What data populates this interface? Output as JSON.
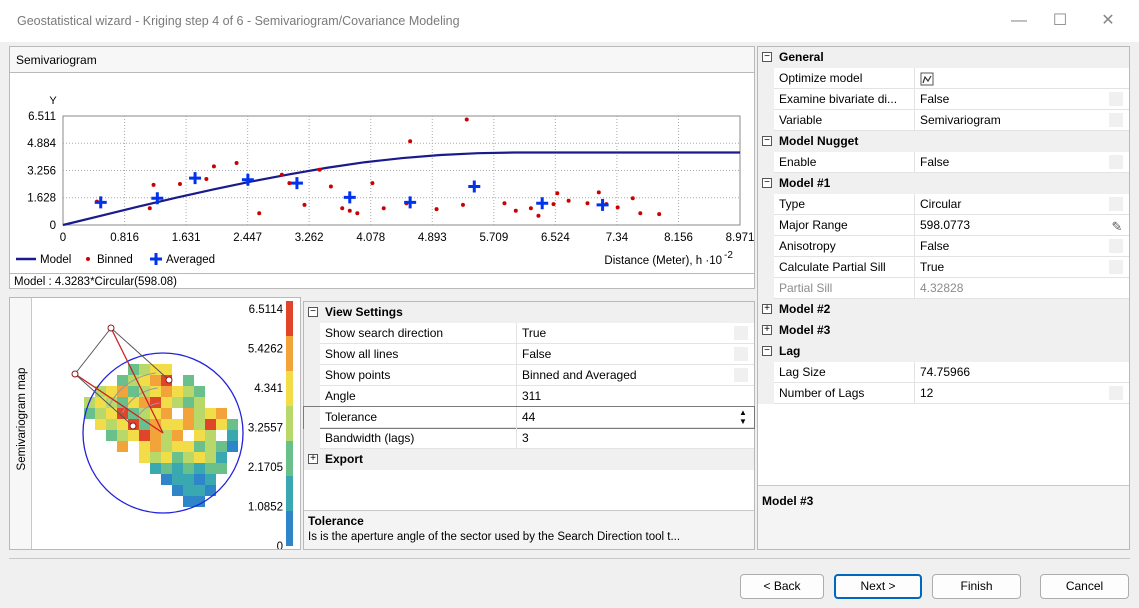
{
  "window": {
    "title": "Geostatistical wizard - Kriging step 4 of 6 - Semivariogram/Covariance Modeling"
  },
  "semivariogram": {
    "header": "Semivariogram",
    "model_text": "Model : 4.3283*Circular(598.08)",
    "legend": {
      "model": "Model",
      "binned": "Binned",
      "averaged": "Averaged"
    },
    "xaxis_caption": "Distance (Meter), h ·10",
    "xaxis_exponent": "-2"
  },
  "chart_data": {
    "type": "scatter",
    "ylabel": "Y",
    "xlabel": "Distance (Meter), h ·10-2",
    "x_ticks": [
      "0",
      "0.816",
      "1.631",
      "2.447",
      "3.262",
      "4.078",
      "4.893",
      "5.709",
      "6.524",
      "7.34",
      "8.156",
      "8.971"
    ],
    "y_ticks": [
      "0",
      "1.628",
      "3.256",
      "4.884",
      "6.511"
    ],
    "xlim": [
      0,
      8.971
    ],
    "ylim": [
      0,
      6.511
    ],
    "grid": true,
    "legend_position": "bottom-left",
    "series": [
      {
        "name": "Model",
        "kind": "line",
        "color": "#1a1a8c",
        "x": [
          0,
          0.5,
          1.0,
          1.5,
          2.0,
          2.5,
          3.0,
          3.5,
          4.0,
          4.5,
          5.0,
          5.5,
          5.98,
          7.0,
          8.971
        ],
        "y": [
          0,
          0.55,
          1.1,
          1.63,
          2.13,
          2.6,
          3.03,
          3.42,
          3.75,
          4.0,
          4.18,
          4.29,
          4.33,
          4.33,
          4.33
        ]
      },
      {
        "name": "Binned",
        "kind": "dot",
        "color": "#cc0000",
        "x": [
          0.45,
          1.2,
          1.15,
          1.55,
          1.9,
          2.0,
          2.3,
          2.6,
          2.9,
          3.0,
          3.2,
          3.4,
          3.55,
          3.7,
          3.8,
          3.9,
          4.1,
          4.25,
          4.55,
          4.6,
          4.95,
          5.3,
          5.35,
          5.85,
          6.0,
          6.2,
          6.3,
          6.5,
          6.55,
          6.7,
          6.95,
          7.1,
          7.2,
          7.35,
          7.55,
          7.65,
          7.9
        ],
        "y": [
          1.4,
          2.4,
          1.0,
          2.45,
          2.75,
          3.5,
          3.7,
          0.7,
          3.0,
          2.5,
          1.2,
          3.3,
          2.3,
          1.0,
          0.85,
          0.7,
          2.5,
          1.0,
          1.3,
          5.0,
          0.95,
          1.2,
          6.3,
          1.3,
          0.85,
          1.0,
          0.55,
          1.25,
          1.9,
          1.45,
          1.3,
          1.95,
          1.25,
          1.05,
          1.6,
          0.7,
          0.65
        ]
      },
      {
        "name": "Averaged",
        "kind": "cross",
        "color": "#0033ee",
        "x": [
          0.5,
          1.25,
          1.75,
          2.45,
          3.1,
          3.8,
          4.6,
          5.45,
          6.35,
          7.15
        ],
        "y": [
          1.35,
          1.6,
          2.8,
          2.7,
          2.5,
          1.65,
          1.35,
          2.3,
          1.3,
          1.2
        ]
      }
    ]
  },
  "map": {
    "side_label": "Semivariogram map",
    "scale_labels": [
      "6.5114",
      "5.4262",
      "4.341",
      "3.2557",
      "2.1705",
      "1.0852",
      "0"
    ]
  },
  "view_settings": {
    "category": "View Settings",
    "rows": [
      {
        "name": "Show search direction",
        "value": "True"
      },
      {
        "name": "Show all lines",
        "value": "False"
      },
      {
        "name": "Show points",
        "value": "Binned and Averaged"
      },
      {
        "name": "Angle",
        "value": "311"
      },
      {
        "name": "Tolerance",
        "value": "44"
      },
      {
        "name": "Bandwidth (lags)",
        "value": "3"
      }
    ],
    "export_category": "Export",
    "help_title": "Tolerance",
    "help_text": "Is is the aperture angle of the sector used by the Search Direction tool t..."
  },
  "model_props": {
    "general": {
      "category": "General",
      "rows": [
        {
          "name": "Optimize model",
          "value": ""
        },
        {
          "name": "Examine bivariate di...",
          "value": "False"
        },
        {
          "name": "Variable",
          "value": "Semivariogram"
        }
      ]
    },
    "nugget": {
      "category": "Model Nugget",
      "rows": [
        {
          "name": "Enable",
          "value": "False"
        }
      ]
    },
    "model1": {
      "category": "Model #1",
      "rows": [
        {
          "name": "Type",
          "value": "Circular"
        },
        {
          "name": "Major Range",
          "value": "598.0773"
        },
        {
          "name": "Anisotropy",
          "value": "False"
        },
        {
          "name": "Calculate Partial Sill",
          "value": "True"
        },
        {
          "name": "Partial Sill",
          "value": "4.32828"
        }
      ]
    },
    "model2": {
      "category": "Model #2"
    },
    "model3": {
      "category": "Model #3"
    },
    "lag": {
      "category": "Lag",
      "rows": [
        {
          "name": "Lag Size",
          "value": "74.75966"
        },
        {
          "name": "Number of Lags",
          "value": "12"
        }
      ]
    },
    "description_title": "Model #3"
  },
  "buttons": {
    "back": "< Back",
    "next": "Next >",
    "finish": "Finish",
    "cancel": "Cancel"
  }
}
